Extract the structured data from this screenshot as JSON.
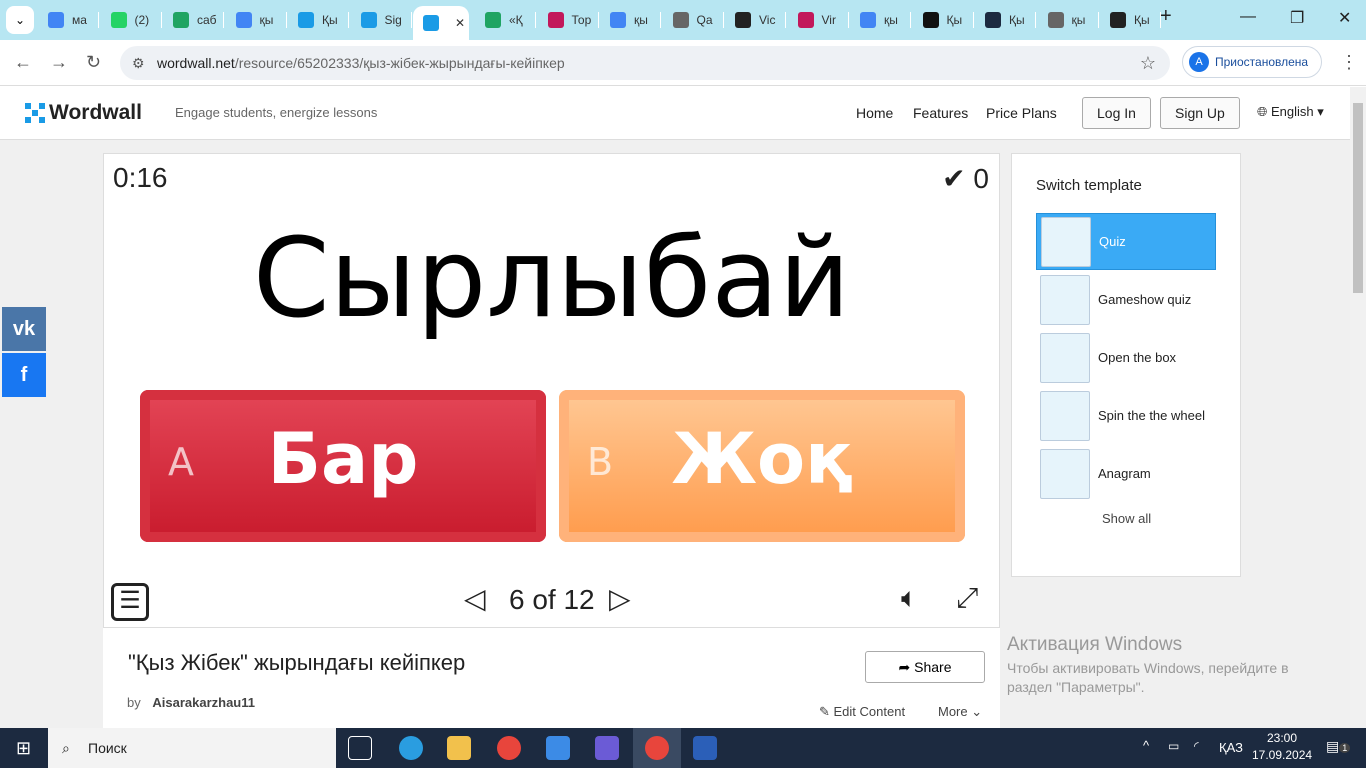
{
  "browser": {
    "tabs": [
      {
        "label": "ма",
        "icon": "google-icon"
      },
      {
        "label": "(2)",
        "icon": "whatsapp-icon"
      },
      {
        "label": "саб",
        "icon": "sheets-icon"
      },
      {
        "label": "қы",
        "icon": "google-icon"
      },
      {
        "label": "Қы",
        "icon": "wordwall-icon"
      },
      {
        "label": "Sig",
        "icon": "wordwall-icon"
      },
      {
        "label": "",
        "icon": "wordwall-icon",
        "active": true
      },
      {
        "label": "«Қ",
        "icon": "b-icon"
      },
      {
        "label": "Тор",
        "icon": "site-icon"
      },
      {
        "label": "қы",
        "icon": "google-icon"
      },
      {
        "label": "Qa",
        "icon": "globe-icon"
      },
      {
        "label": "Vic",
        "icon": "did-icon"
      },
      {
        "label": "Vir",
        "icon": "site-icon"
      },
      {
        "label": "қы",
        "icon": "google-icon"
      },
      {
        "label": "Қы",
        "icon": "tiktok-icon"
      },
      {
        "label": "Қы",
        "icon": "ba-icon"
      },
      {
        "label": "қы",
        "icon": "globe-icon"
      },
      {
        "label": "Қы",
        "icon": "film-icon"
      }
    ],
    "url_host": "wordwall.net",
    "url_path": "/resource/65202333/қыз-жібек-жырындағы-кейіпкер",
    "profile_initial": "A",
    "profile_label": "Приостановлена"
  },
  "site": {
    "brand": "Wordwall",
    "tagline": "Engage students, energize lessons",
    "nav": [
      "Home",
      "Features",
      "Price Plans"
    ],
    "login": "Log In",
    "signup": "Sign Up",
    "language": "English"
  },
  "game": {
    "timer": "0:16",
    "score": "0",
    "question": "Сырлыбай",
    "answers": [
      {
        "letter": "A",
        "text": "Бар",
        "color": "#d42435"
      },
      {
        "letter": "B",
        "text": "Жоқ",
        "color": "#ffb070"
      }
    ],
    "page": "6 of 12"
  },
  "activity": {
    "title": "\"Қыз Жібек\" жырындағы кейіпкер",
    "by": "by",
    "author": "Aisarakarzhau11",
    "share": "Share",
    "edit": "Edit Content",
    "more": "More"
  },
  "sidebar": {
    "title": "Switch template",
    "templates": [
      "Quiz",
      "Gameshow quiz",
      "Open the box",
      "Spin the the wheel",
      "Anagram"
    ],
    "show_all": "Show all"
  },
  "activation": {
    "title": "Активация Windows",
    "line1": "Чтобы активировать Windows, перейдите в",
    "line2": "раздел \"Параметры\"."
  },
  "taskbar": {
    "search": "Поиск",
    "lang": "ҚАЗ",
    "time": "23:00",
    "date": "17.09.2024",
    "notifications": "1"
  }
}
